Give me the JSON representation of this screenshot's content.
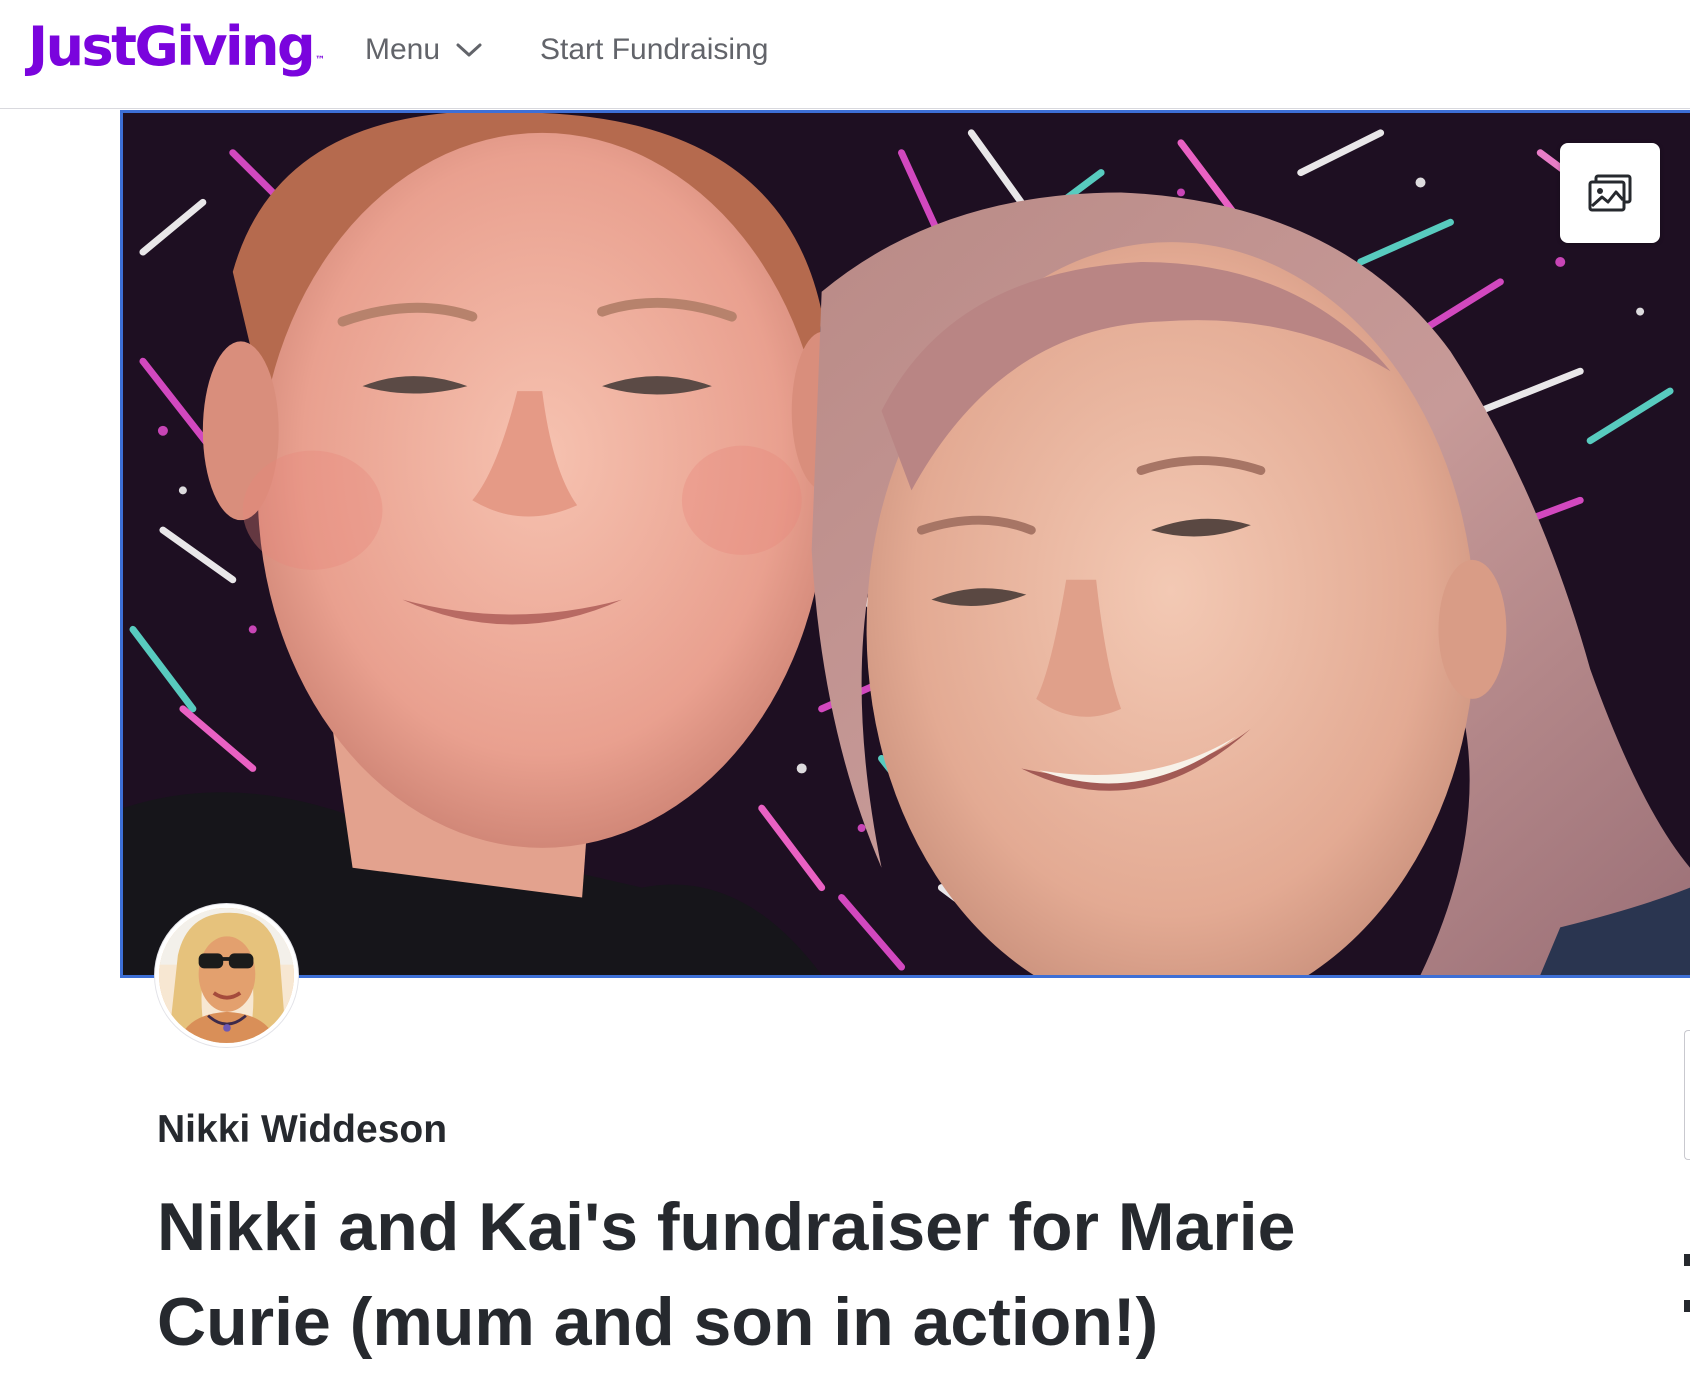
{
  "header": {
    "logo_text": "JustGiving",
    "logo_tm": "™",
    "menu_label": "Menu",
    "start_label": "Start Fundraising"
  },
  "hero": {
    "gallery_icon": "image-gallery-icon"
  },
  "page": {
    "owner_name": "Nikki Widdeson",
    "title": "Nikki and Kai's fundraiser for Marie Curie (mum and son in action!)"
  },
  "colors": {
    "brand": "#7a04dd",
    "text": "#26292e",
    "nav_text": "#62646a",
    "hero_border": "#3d6fd6"
  }
}
